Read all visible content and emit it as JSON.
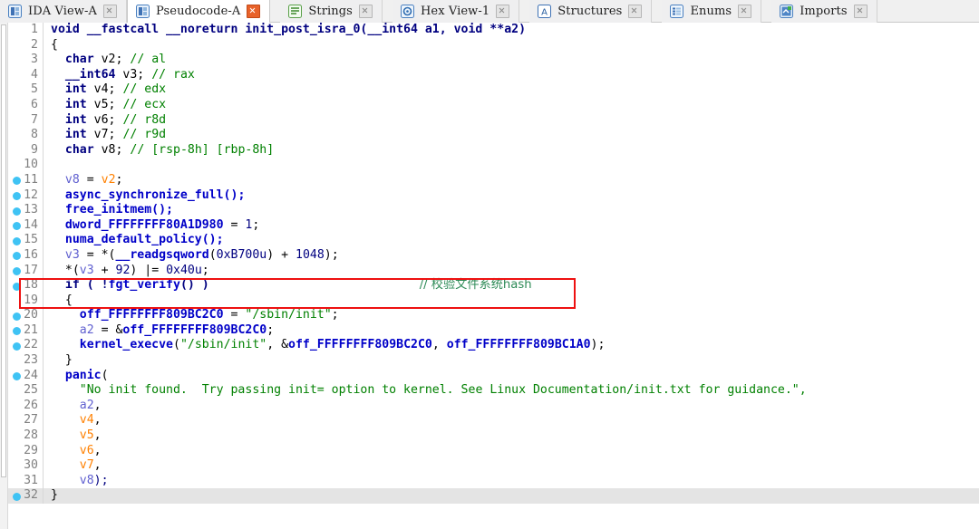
{
  "window": {
    "title": "IDA Pseudocode View"
  },
  "tabs": [
    {
      "label": "IDA View-A",
      "icon": "ida-view-icon",
      "active": false,
      "close_accent": false
    },
    {
      "label": "Pseudocode-A",
      "icon": "pseudocode-icon",
      "active": true,
      "close_accent": true
    },
    {
      "label": "Strings",
      "icon": "strings-icon",
      "active": false,
      "close_accent": false
    },
    {
      "label": "Hex View-1",
      "icon": "hex-view-icon",
      "active": false,
      "close_accent": false
    },
    {
      "label": "Structures",
      "icon": "structures-icon",
      "active": false,
      "close_accent": false
    },
    {
      "label": "Enums",
      "icon": "enums-icon",
      "active": false,
      "close_accent": false
    },
    {
      "label": "Imports",
      "icon": "imports-icon",
      "active": false,
      "close_accent": false
    }
  ],
  "colors": {
    "keyword": "#000080",
    "function": "#0000c8",
    "local_var": "#ff8000",
    "arg_var": "#6060d0",
    "string": "#008000",
    "comment": "#008000",
    "gutter_dot": "#3fc3f4",
    "annotation": "#ee1111",
    "cursor_line": "#e4e4e4",
    "tab_close_accent": "#e8622a"
  },
  "annotation": {
    "shape": "rectangle",
    "covers_lines": "17-19",
    "color": "#ee1111"
  },
  "code": {
    "function_name": "init_post_isra_0",
    "lines": [
      {
        "n": "1",
        "dot": false,
        "cursor": false
      },
      {
        "n": "2",
        "dot": false,
        "cursor": false
      },
      {
        "n": "3",
        "dot": false,
        "cursor": false
      },
      {
        "n": "4",
        "dot": false,
        "cursor": false
      },
      {
        "n": "5",
        "dot": false,
        "cursor": false
      },
      {
        "n": "6",
        "dot": false,
        "cursor": false
      },
      {
        "n": "7",
        "dot": false,
        "cursor": false
      },
      {
        "n": "8",
        "dot": false,
        "cursor": false
      },
      {
        "n": "9",
        "dot": false,
        "cursor": false
      },
      {
        "n": "10",
        "dot": false,
        "cursor": false
      },
      {
        "n": "11",
        "dot": true,
        "cursor": false
      },
      {
        "n": "12",
        "dot": true,
        "cursor": false
      },
      {
        "n": "13",
        "dot": true,
        "cursor": false
      },
      {
        "n": "14",
        "dot": true,
        "cursor": false
      },
      {
        "n": "15",
        "dot": true,
        "cursor": false
      },
      {
        "n": "16",
        "dot": true,
        "cursor": false
      },
      {
        "n": "17",
        "dot": true,
        "cursor": false
      },
      {
        "n": "18",
        "dot": true,
        "cursor": false
      },
      {
        "n": "19",
        "dot": false,
        "cursor": false
      },
      {
        "n": "20",
        "dot": true,
        "cursor": false
      },
      {
        "n": "21",
        "dot": true,
        "cursor": false
      },
      {
        "n": "22",
        "dot": true,
        "cursor": false
      },
      {
        "n": "23",
        "dot": false,
        "cursor": false
      },
      {
        "n": "24",
        "dot": true,
        "cursor": false
      },
      {
        "n": "25",
        "dot": false,
        "cursor": false
      },
      {
        "n": "26",
        "dot": false,
        "cursor": false
      },
      {
        "n": "27",
        "dot": false,
        "cursor": false
      },
      {
        "n": "28",
        "dot": false,
        "cursor": false
      },
      {
        "n": "29",
        "dot": false,
        "cursor": false
      },
      {
        "n": "30",
        "dot": false,
        "cursor": false
      },
      {
        "n": "31",
        "dot": false,
        "cursor": false
      },
      {
        "n": "32",
        "dot": true,
        "cursor": true
      }
    ],
    "text": {
      "l1": "void __fastcall __noreturn init_post_isra_0(__int64 a1, void **a2)",
      "l2": "{",
      "l3_type": "char",
      "l3_var": "v2;",
      "l3_cmt": "// al",
      "l4_type": "__int64",
      "l4_var": "v3;",
      "l4_cmt": "// rax",
      "l5_type": "int",
      "l5_var": "v4;",
      "l5_cmt": "// edx",
      "l6_type": "int",
      "l6_var": "v5;",
      "l6_cmt": "// ecx",
      "l7_type": "int",
      "l7_var": "v6;",
      "l7_cmt": "// r8d",
      "l8_type": "int",
      "l8_var": "v7;",
      "l8_cmt": "// r9d",
      "l9_type": "char",
      "l9_var": "v8;",
      "l9_cmt": "// [rsp-8h] [rbp-8h]",
      "l10": "",
      "l11_a": "v8",
      "l11_b": "= ",
      "l11_c": "v2",
      "l11_d": ";",
      "l12": "async_synchronize_full();",
      "l13": "free_initmem();",
      "l14_a": "dword_FFFFFFFF80A1D980",
      "l14_b": " = ",
      "l14_c": "1",
      "l14_d": ";",
      "l15": "numa_default_policy();",
      "l16_a": "v3",
      "l16_b": " = *(",
      "l16_c": "__readgsqword",
      "l16_d": "(",
      "l16_e": "0xB700u",
      "l16_f": ") + ",
      "l16_g": "1048",
      "l16_h": ");",
      "l17_a": "*(",
      "l17_b": "v3",
      "l17_c": " + ",
      "l17_d": "92",
      "l17_e": ") |= ",
      "l17_f": "0x40u",
      "l17_g": ";",
      "l18_a": "if ( !",
      "l18_b": "fgt_verify",
      "l18_c": "() )",
      "l18_comment": "// 校验文件系统hash",
      "l19": "{",
      "l20_a": "off_FFFFFFFF809BC2C0",
      "l20_b": " = ",
      "l20_c": "\"/sbin/init\"",
      "l20_d": ";",
      "l21_a": "a2",
      "l21_b": " = &",
      "l21_c": "off_FFFFFFFF809BC2C0",
      "l21_d": ";",
      "l22_a": "kernel_execve",
      "l22_b": "(",
      "l22_c": "\"/sbin/init\"",
      "l22_d": ", &",
      "l22_e": "off_FFFFFFFF809BC2C0",
      "l22_f": ", ",
      "l22_g": "off_FFFFFFFF809BC1A0",
      "l22_h": ");",
      "l23": "}",
      "l24_a": "panic",
      "l24_b": "(",
      "l25": "\"No init found.  Try passing init= option to kernel. See Linux Documentation/init.txt for guidance.\",",
      "l26_a": "a2",
      "l26_b": ",",
      "l27_a": "v4",
      "l27_b": ",",
      "l28_a": "v5",
      "l28_b": ",",
      "l29_a": "v6",
      "l29_b": ",",
      "l30_a": "v7",
      "l30_b": ",",
      "l31_a": "v8",
      "l31_b": ");",
      "l32": "}"
    }
  }
}
